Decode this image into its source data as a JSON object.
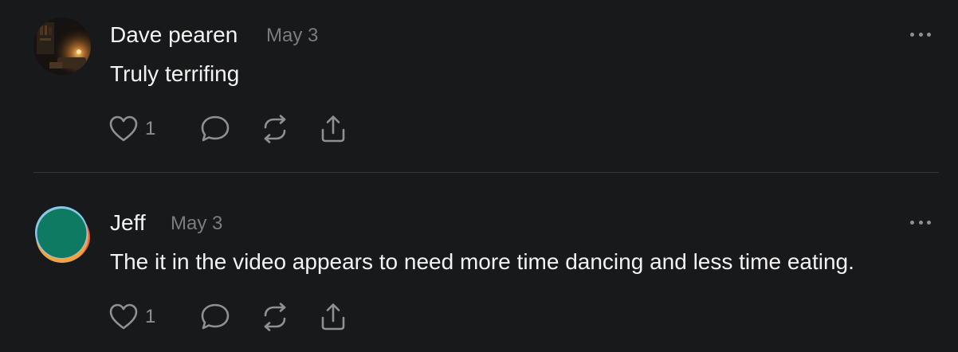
{
  "posts": [
    {
      "author": "Dave pearen",
      "date": "May 3",
      "text": "Truly terrifing",
      "likes": "1",
      "avatar_icon": "avatar-photo-lantern-room"
    },
    {
      "author": "Jeff",
      "date": "May 3",
      "text": "The it in the video appears to need more time dancing and less time eating.",
      "likes": "1",
      "avatar_icon": "avatar-colored-circles"
    }
  ],
  "colors": {
    "background": "#18191b",
    "text_primary": "#f2f2f2",
    "text_secondary": "#7a7c80",
    "icon": "#8e9094",
    "divider": "#34363a"
  },
  "icons": [
    "heart-icon",
    "reply-bubble-icon",
    "repost-icon",
    "share-icon",
    "more-dots-icon"
  ]
}
